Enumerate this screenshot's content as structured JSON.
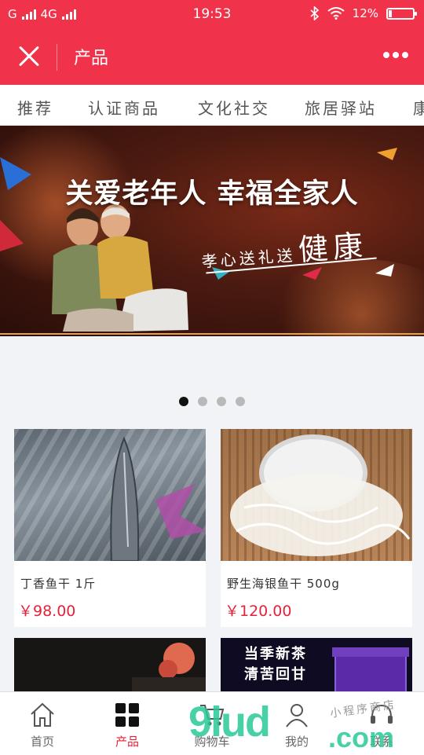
{
  "status_bar": {
    "carrier1": "G",
    "carrier2": "4G",
    "time": "19:53",
    "battery": "12%",
    "battery_level": 0.12
  },
  "nav": {
    "title": "产品"
  },
  "tabs": [
    "推荐",
    "认证商品",
    "文化社交",
    "旅居驿站",
    "康"
  ],
  "banner": {
    "headline": "关爱老年人 幸福全家人",
    "tagline_small": "孝心送礼送",
    "tagline_big": "健康"
  },
  "carousel": {
    "total": 4,
    "active_index": 0
  },
  "products": [
    {
      "name": "丁香鱼干 1斤",
      "price": "￥98.00"
    },
    {
      "name": "野生海银鱼干 500g",
      "price": "￥120.00"
    }
  ],
  "products_partial": [
    {
      "text1": ""
    },
    {
      "text1": "当季新茶",
      "text2": "清苦回甘"
    }
  ],
  "bottom_tabs": [
    {
      "label": "首页",
      "active": false
    },
    {
      "label": "产品",
      "active": true
    },
    {
      "label": "购物车",
      "active": false
    },
    {
      "label": "我的",
      "active": false
    },
    {
      "label": "联系",
      "active": false
    }
  ],
  "watermark": {
    "text1": "9lud",
    "text2": ".com",
    "text3": "小程序商店"
  },
  "colors": {
    "brand": "#f0324a",
    "price": "#e6213a",
    "watermark": "#28c896"
  }
}
